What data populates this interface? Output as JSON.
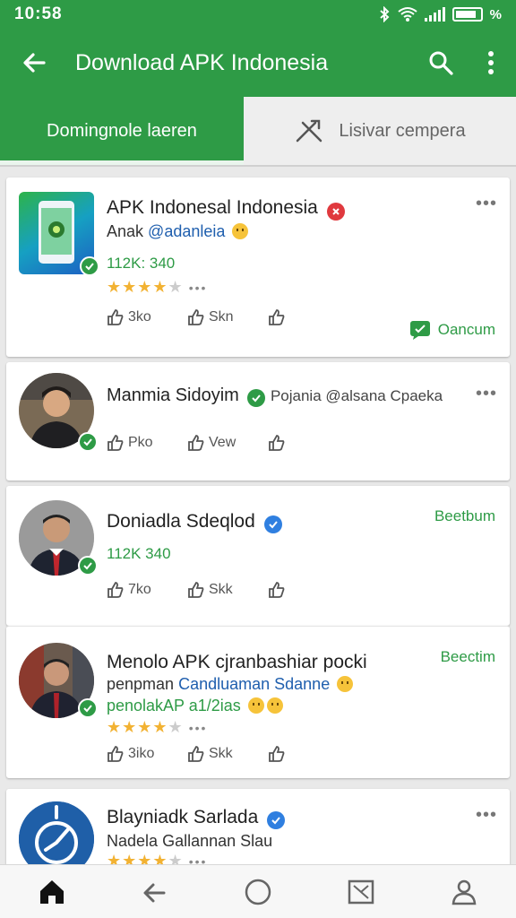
{
  "status_bar": {
    "time": "10:58",
    "battery_label": "%"
  },
  "app_bar": {
    "title": "Download APK Indonesia"
  },
  "tabs": [
    {
      "label": "Domingnole laeren"
    },
    {
      "label": "Lisivar cempera"
    }
  ],
  "feed": [
    {
      "name": "APK Indonesal Indonesia",
      "line2_prefix": "Anak",
      "line2_handle": "@adanleia",
      "stats": "112K: 340",
      "rating": 4,
      "actions": [
        "3ko",
        "Skn",
        ""
      ],
      "download_label": "Oancum"
    },
    {
      "name": "Manmia Sidoyim",
      "name_suffix": "Pojania @alsana Cpaeka",
      "actions": [
        "Pko",
        "Vew",
        ""
      ]
    },
    {
      "name": "Doniadla Sdeqlod",
      "follow_label": "Beetbum",
      "stats": "112K 340",
      "actions": [
        "7ko",
        "Skk",
        ""
      ]
    },
    {
      "name": "Menolo APK cjranbashiar pocki",
      "line2_prefix": "penpman",
      "line2_handle": "Candluaman Sdanne",
      "line3": "penolakAP a1/2ias",
      "rating": 4,
      "follow_label": "Beectim",
      "actions": [
        "3iko",
        "Skk",
        ""
      ]
    },
    {
      "name": "Blayniadk Sarlada",
      "line2_prefix": "Nadela",
      "line2_handle": "Gallannan Slau",
      "rating": 4
    }
  ],
  "colors": {
    "brand_green": "#2e9b46",
    "verified_red": "#e0393e",
    "verified_blue": "#2f7fe0",
    "star": "#f2b233"
  },
  "icons": [
    "back-icon",
    "search-icon",
    "more-icon",
    "tools-icon",
    "like-icon",
    "repost-icon",
    "share-icon",
    "chat-icon",
    "home-icon",
    "nav-back-icon",
    "circle-icon",
    "recent-icon",
    "profile-icon"
  ]
}
